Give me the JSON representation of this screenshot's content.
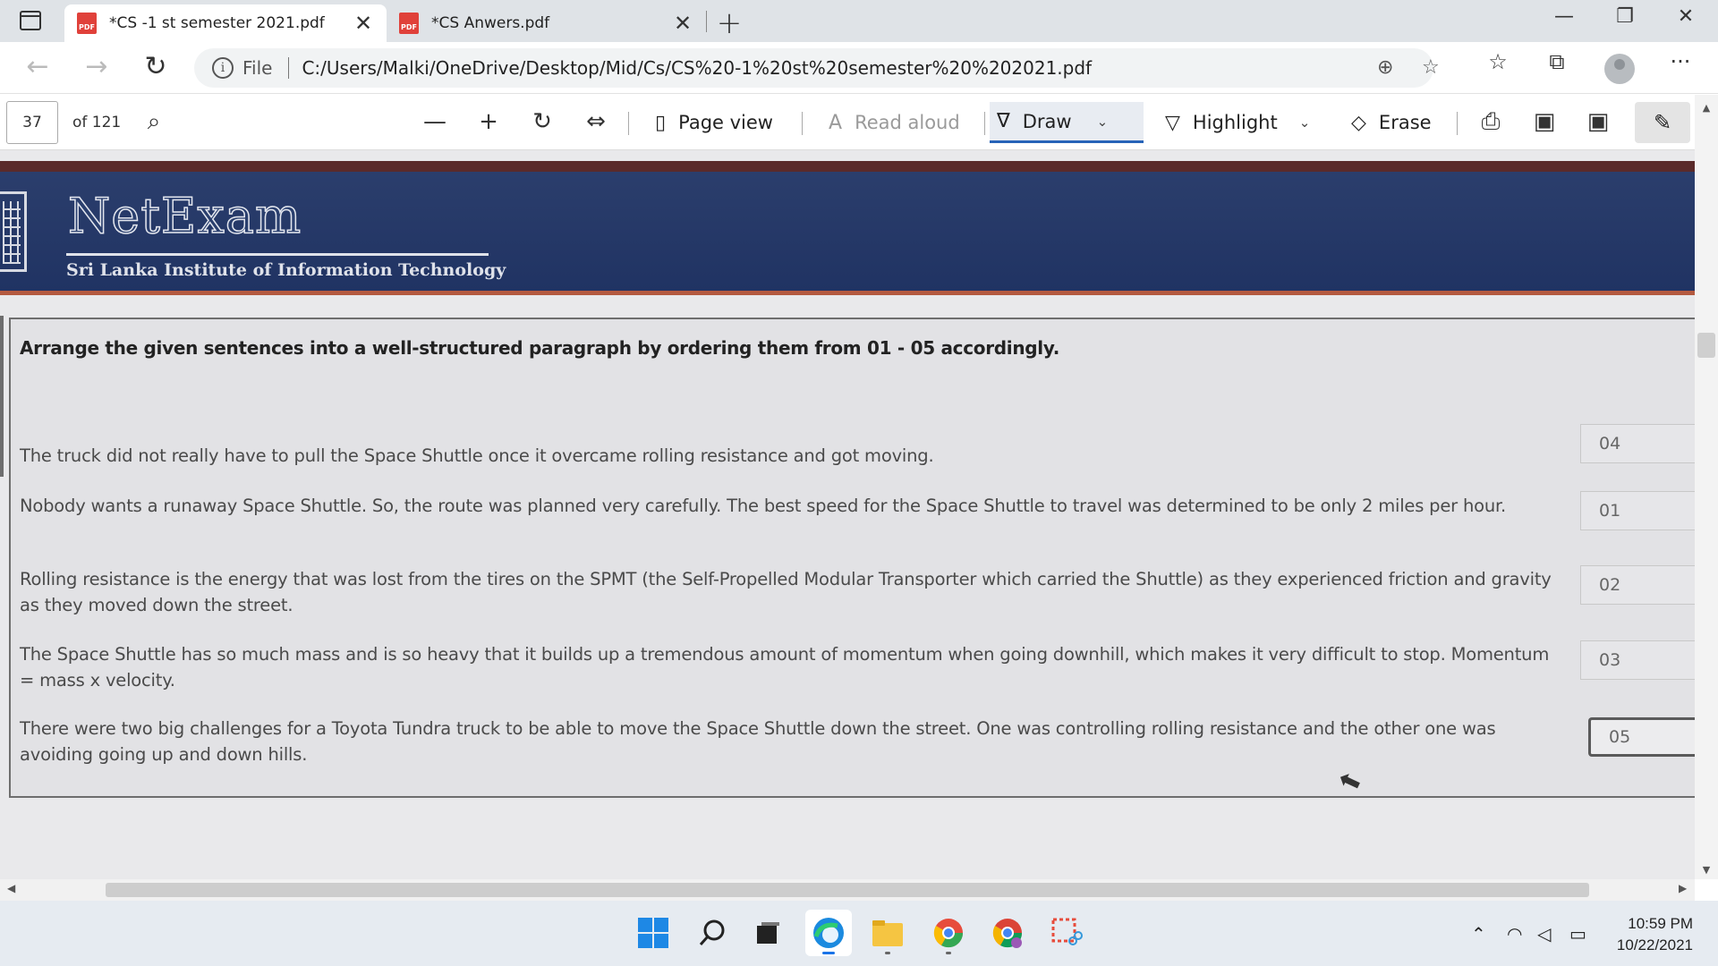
{
  "tabs": [
    {
      "title": "*CS -1 st semester 2021.pdf",
      "active": true
    },
    {
      "title": "*CS Anwers.pdf",
      "active": false
    }
  ],
  "icons": {
    "pdf_badge": "PDF",
    "close": "✕",
    "new_tab": "+",
    "minimize": "—",
    "maximize": "❐",
    "window_close": "✕",
    "back": "←",
    "forward": "→",
    "reload": "↻",
    "info": "i",
    "zoom": "⊕",
    "favorite_add": "☆",
    "favorites": "☆",
    "collections": "⧉",
    "more": "···",
    "search": "⌕",
    "zoom_out": "—",
    "zoom_in": "+",
    "rotate": "↻",
    "fit": "⇔",
    "page_view": "▯",
    "read_aloud": "A",
    "draw": "∇",
    "highlight": "▽",
    "erase": "◇",
    "print": "⎙",
    "save": "▣",
    "save_as": "▣",
    "pin": "✎",
    "dropdown": "⌄",
    "scroll_up": "▲",
    "scroll_down": "▼",
    "scroll_left": "◀",
    "scroll_right": "▶",
    "pointer": "⬉",
    "chevron_up": "⌃",
    "wifi": "◠",
    "volume": "◁",
    "battery": "▭"
  },
  "address": {
    "file_label": "File",
    "url": "C:/Users/Malki/OneDrive/Desktop/Mid/Cs/CS%20-1%20st%20semester%20%202021.pdf"
  },
  "pdf_toolbar": {
    "page_number": "37",
    "total_pages": "of 121",
    "page_view": "Page view",
    "read_aloud": "Read aloud",
    "draw": "Draw",
    "highlight": "Highlight",
    "erase": "Erase"
  },
  "document": {
    "brand": "NetExam",
    "brand_subtitle": "Sri Lanka Institute of Information Technology",
    "instruction": "Arrange the given sentences into a well-structured paragraph by ordering them from 01 - 05 accordingly.",
    "items": [
      {
        "text": "The truck did not really have to pull the Space Shuttle once it overcame rolling resistance and got moving.",
        "answer": "04"
      },
      {
        "text": "Nobody wants a runaway Space Shuttle. So, the route was planned very carefully. The best speed for the Space Shuttle to travel was determined to be only 2 miles per hour.",
        "answer": "01"
      },
      {
        "text": "Rolling resistance is the energy that was lost from the tires on the SPMT (the Self-Propelled Modular Transporter which carried the Shuttle) as they experienced friction and gravity as they moved down the street.",
        "answer": "02"
      },
      {
        "text": "The Space Shuttle has so much mass and is so heavy that it builds up a tremendous amount of momentum when going downhill, which makes it very difficult to stop. Momentum = mass x velocity.",
        "answer": "03"
      },
      {
        "text": "There were two big challenges for a Toyota Tundra truck to be able to move the Space Shuttle down the street. One was controlling rolling resistance and the other one was avoiding going up and down hills.",
        "answer": "05"
      }
    ]
  },
  "taskbar": {
    "time": "10:59 PM",
    "date": "10/22/2021"
  }
}
